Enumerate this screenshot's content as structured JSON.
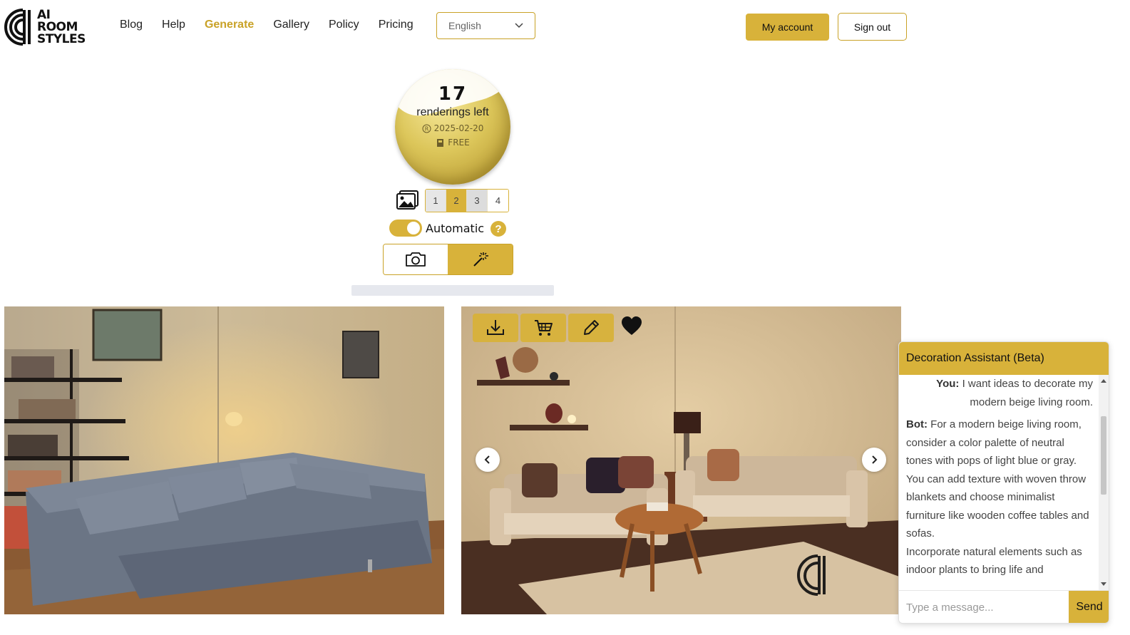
{
  "brand": {
    "logo_lines": [
      "AI",
      "ROOM",
      "STYLES"
    ],
    "accent": "#d8b23a"
  },
  "nav": {
    "items": [
      "Blog",
      "Help",
      "Generate",
      "Gallery",
      "Policy",
      "Pricing"
    ],
    "active": "Generate"
  },
  "language": {
    "selected": "English"
  },
  "header_buttons": {
    "account": "My account",
    "signout": "Sign out"
  },
  "credits": {
    "count": "17",
    "label": "renderings left",
    "expiry": "2025-02-20",
    "plan": "FREE"
  },
  "render_count": {
    "options": [
      "1",
      "2",
      "3",
      "4"
    ],
    "selected": "2"
  },
  "automatic": {
    "label": "Automatic",
    "enabled": true,
    "help": "?"
  },
  "modes": {
    "photo_icon": "camera-icon",
    "generate_icon": "magic-wand-icon",
    "selected": "generate"
  },
  "image_tools": [
    "download-icon",
    "cart-icon",
    "pencil-icon",
    "heart-icon"
  ],
  "chat": {
    "title": "Decoration Assistant (Beta)",
    "user_prefix": "You:",
    "user_message": "I want ideas to decorate my modern beige living room.",
    "bot_prefix": "Bot:",
    "bot_message_1": "For a modern beige living room, consider a color palette of neutral tones with pops of light blue or gray.",
    "bot_message_2": "You can add texture with woven throw blankets and choose minimalist furniture like wooden coffee tables and sofas.",
    "bot_message_3": "Incorporate natural elements such as indoor plants to bring life and",
    "input_placeholder": "Type a message...",
    "send_label": "Send"
  }
}
